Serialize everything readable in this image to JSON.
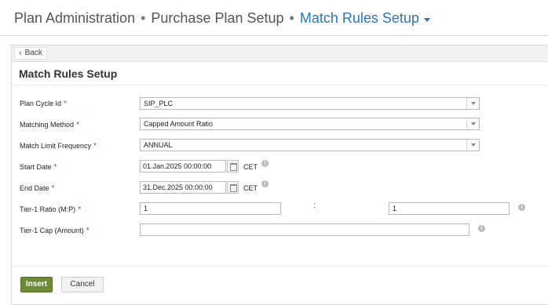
{
  "breadcrumb": {
    "items": [
      "Plan Administration",
      "Purchase Plan Setup"
    ],
    "current": "Match Rules Setup",
    "separator": "•"
  },
  "toolbar": {
    "back_label": "Back"
  },
  "form": {
    "title": "Match Rules Setup",
    "required_marker": "*",
    "plan_cycle": {
      "label": "Plan Cycle Id",
      "value": "SIP_PLC"
    },
    "matching_method": {
      "label": "Matching Method",
      "value": "Capped Amount Ratio"
    },
    "match_limit_frequency": {
      "label": "Match Limit Frequency",
      "value": "ANNUAL"
    },
    "start_date": {
      "label": "Start Date",
      "value": "01.Jan.2025 00:00:00",
      "timezone": "CET"
    },
    "end_date": {
      "label": "End Date",
      "value": "31.Dec.2025 00:00:00",
      "timezone": "CET"
    },
    "tier1_ratio": {
      "label": "Tier-1 Ratio (M:P)",
      "left_value": "1",
      "separator": ":",
      "right_value": "1"
    },
    "tier1_cap": {
      "label": "Tier-1 Cap (Amount)",
      "value": ""
    }
  },
  "actions": {
    "insert_label": "Insert",
    "cancel_label": "Cancel"
  },
  "colors": {
    "accent_blue": "#2f74b5",
    "insert_green": "#6b8c34",
    "required_red": "#d9342b"
  },
  "icons": [
    "chevron-left-icon",
    "dropdown-arrow-icon",
    "calendar-icon",
    "info-icon",
    "caret-down-icon"
  ]
}
